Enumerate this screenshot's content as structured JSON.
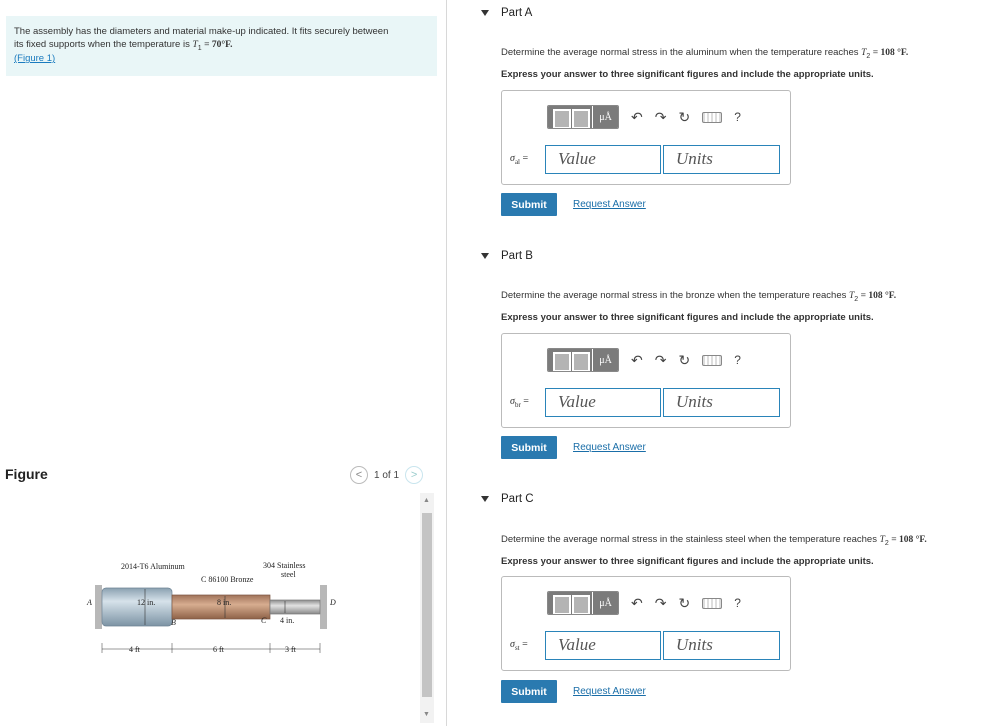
{
  "intro": {
    "line1": "The assembly has the diameters and material make-up indicated. It fits securely between",
    "line2_prefix": "its fixed supports when the temperature is ",
    "t1_symbol": "T",
    "t1_sub": "1",
    "t1_value": " = 70°F.",
    "figure_link": "(Figure 1)"
  },
  "figure_panel": {
    "label": "Figure",
    "pager_text": "1 of 1",
    "prev_icon": "<",
    "next_icon": ">",
    "labels": {
      "aluminum": "2014-T6 Aluminum",
      "bronze": "C 86100 Bronze",
      "steel_1": "304 Stainless",
      "steel_2": "steel",
      "d_al": "12 in.",
      "d_br": "8 in.",
      "d_st": "4 in.",
      "pt_a": "A",
      "pt_b": "B",
      "pt_c": "C",
      "pt_d": "D",
      "len_al": "4 ft",
      "len_br": "6 ft",
      "len_st": "3 ft"
    }
  },
  "parts": [
    {
      "title": "Part A",
      "question_prefix": "Determine the average normal stress in the aluminum when the temperature reaches ",
      "t2": "T",
      "t2_sub": "2",
      "t2_value": " = 108 °F.",
      "instruction": "Express your answer to three significant figures and include the appropriate units.",
      "symbol": "σ",
      "symbol_sub": "al",
      "equals": "=",
      "value_placeholder": "Value",
      "units_placeholder": "Units",
      "submit": "Submit",
      "request": "Request Answer"
    },
    {
      "title": "Part B",
      "question_prefix": "Determine the average normal stress in the bronze when the temperature reaches ",
      "t2": "T",
      "t2_sub": "2",
      "t2_value": " = 108 °F.",
      "instruction": "Express your answer to three significant figures and include the appropriate units.",
      "symbol": "σ",
      "symbol_sub": "br",
      "equals": "=",
      "value_placeholder": "Value",
      "units_placeholder": "Units",
      "submit": "Submit",
      "request": "Request Answer"
    },
    {
      "title": "Part C",
      "question_prefix": "Determine the average normal stress in the stainless steel when the temperature reaches ",
      "t2": "T",
      "t2_sub": "2",
      "t2_value": " = 108 °F.",
      "instruction": "Express your answer to three significant figures and include the appropriate units.",
      "symbol": "σ",
      "symbol_sub": "st",
      "equals": "=",
      "value_placeholder": "Value",
      "units_placeholder": "Units",
      "submit": "Submit",
      "request": "Request Answer"
    }
  ],
  "toolbar": {
    "mu_label": "μÅ",
    "undo_icon": "↶",
    "redo_icon": "↷",
    "reset_icon": "↻",
    "help_label": "?"
  }
}
